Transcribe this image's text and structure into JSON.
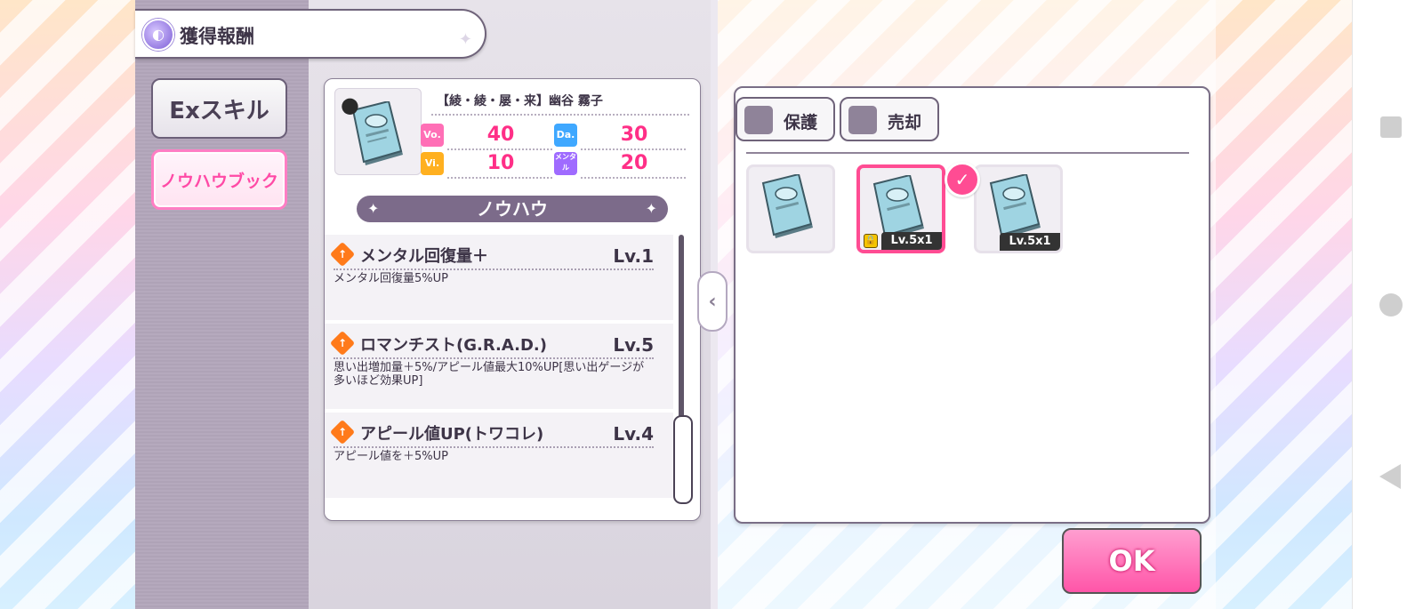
{
  "header": {
    "title": "獲得報酬",
    "icon": "reward-gem-icon"
  },
  "side_tabs": [
    {
      "label": "Exスキル",
      "active": false
    },
    {
      "label": "ノウハウブック",
      "active": true
    }
  ],
  "detail": {
    "idol_title": "【綾・綾・屡・来】幽谷 霧子",
    "stats": [
      {
        "badge": "Vo.",
        "value": "40",
        "color": "#ff6fb6"
      },
      {
        "badge": "Da.",
        "value": "30",
        "color": "#3fa8ff"
      },
      {
        "badge": "Vi.",
        "value": "10",
        "color": "#ffb020"
      },
      {
        "badge": "メンタル",
        "value": "20",
        "color": "#9f6bff"
      }
    ],
    "knowhow_header": "ノウハウ",
    "skills": [
      {
        "name": "メンタル回復量＋",
        "level": "Lv.1",
        "desc": "メンタル回復量5%UP"
      },
      {
        "name": "ロマンチスト(G.R.A.D.)",
        "level": "Lv.5",
        "desc": "思い出増加量＋5%/アピール値最大10%UP[思い出ゲージが多いほど効果UP]"
      },
      {
        "name": "アピール値UP(トワコレ)",
        "level": "Lv.4",
        "desc": "アピール値を＋5%UP"
      }
    ]
  },
  "filters": [
    {
      "label": "保護"
    },
    {
      "label": "売却"
    }
  ],
  "items": [
    {
      "level": "",
      "selected": false,
      "locked": false
    },
    {
      "level": "Lv.5x1",
      "selected": true,
      "locked": true
    },
    {
      "level": "Lv.5x1",
      "selected": false,
      "locked": false
    }
  ],
  "ok_label": "OK"
}
